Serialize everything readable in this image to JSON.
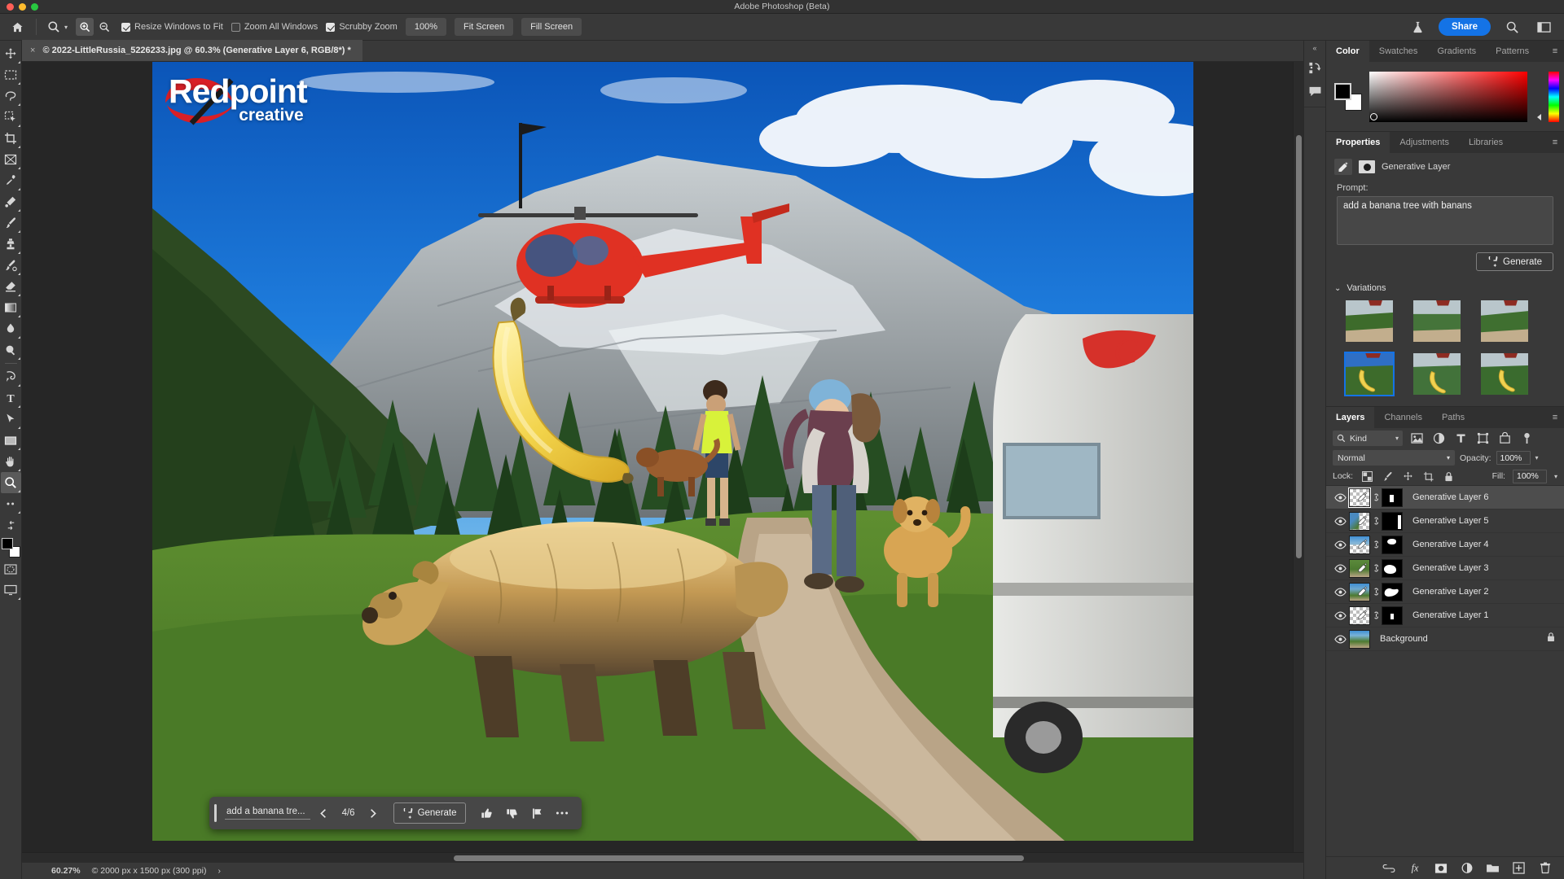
{
  "app": {
    "title": "Adobe Photoshop (Beta)"
  },
  "options_bar": {
    "home_icon": "home-icon",
    "tool_icon": "zoom-tool-icon",
    "zoom_in_icon": "zoom-in-icon",
    "zoom_out_icon": "zoom-out-icon",
    "checkboxes": [
      {
        "label": "Resize Windows to Fit",
        "checked": true
      },
      {
        "label": "Zoom All Windows",
        "checked": false
      },
      {
        "label": "Scrubby Zoom",
        "checked": true
      }
    ],
    "buttons": [
      {
        "label": "100%"
      },
      {
        "label": "Fit Screen"
      },
      {
        "label": "Fill Screen"
      }
    ],
    "share_label": "Share",
    "right_icons": [
      "flask-icon",
      "search-icon",
      "workspace-icon"
    ]
  },
  "document": {
    "tab_title": "© 2022-LittleRussia_5226233.jpg @ 60.3% (Generative Layer 6, RGB/8*) *",
    "close_glyph": "×"
  },
  "status_bar": {
    "zoom": "60.27%",
    "dimensions": "© 2000 px x 1500 px (300 ppi)",
    "chevron": "›"
  },
  "canvas": {
    "watermark_line1": "Redpoint",
    "watermark_line2": "creative",
    "logo_name": "redpoint-logo",
    "brand_color": "#d81f26"
  },
  "gen_taskbar": {
    "prompt_display": "add a banana tre...",
    "prev_glyph": "‹",
    "next_glyph": "›",
    "counter": "4/6",
    "generate_label": "Generate",
    "icons": [
      "thumbs-up-icon",
      "thumbs-down-icon",
      "flag-icon",
      "more-options-icon"
    ]
  },
  "rail": {
    "collapse_glyph": "«",
    "icons": [
      "history-icon",
      "comment-icon"
    ]
  },
  "color_panel": {
    "tabs": [
      {
        "label": "Color",
        "active": true
      },
      {
        "label": "Swatches",
        "active": false
      },
      {
        "label": "Gradients",
        "active": false
      },
      {
        "label": "Patterns",
        "active": false
      }
    ],
    "foreground": "#000000",
    "background": "#ffffff",
    "menu_glyph": "≡"
  },
  "properties_panel": {
    "tabs": [
      {
        "label": "Properties",
        "active": true
      },
      {
        "label": "Adjustments",
        "active": false
      },
      {
        "label": "Libraries",
        "active": false
      }
    ],
    "menu_glyph": "≡",
    "layer_type": "Generative Layer",
    "prompt_label": "Prompt:",
    "prompt_value": "add a banana tree with banans",
    "generate_label": "Generate",
    "variations_label": "Variations",
    "variations_chevron": "⌄",
    "variations": [
      {
        "selected": false,
        "has_banana": false
      },
      {
        "selected": false,
        "has_banana": false
      },
      {
        "selected": false,
        "has_banana": false
      },
      {
        "selected": true,
        "has_banana": true
      },
      {
        "selected": false,
        "has_banana": true
      },
      {
        "selected": false,
        "has_banana": true
      }
    ]
  },
  "layers_panel": {
    "tabs": [
      {
        "label": "Layers",
        "active": true
      },
      {
        "label": "Channels",
        "active": false
      },
      {
        "label": "Paths",
        "active": false
      }
    ],
    "menu_glyph": "≡",
    "filter_kind": "Kind",
    "filter_icons": [
      "pixel-filter-icon",
      "adjustment-filter-icon",
      "type-filter-icon",
      "shape-filter-icon",
      "smartobject-filter-icon"
    ],
    "filter_toggle": "filter-toggle-icon",
    "blend_mode": "Normal",
    "opacity_label": "Opacity:",
    "opacity_value": "100%",
    "lock_label": "Lock:",
    "lock_icons": [
      "lock-transparent-icon",
      "lock-image-icon",
      "lock-position-icon",
      "lock-artboard-icon",
      "lock-all-icon"
    ],
    "fill_label": "Fill:",
    "fill_value": "100%",
    "layers": [
      {
        "name": "Generative Layer 6",
        "visible": true,
        "selected": true,
        "type": "generative",
        "mask": "small-center",
        "locked": false
      },
      {
        "name": "Generative Layer 5",
        "visible": true,
        "selected": false,
        "type": "generative",
        "mask": "right-bar",
        "locked": false
      },
      {
        "name": "Generative Layer 4",
        "visible": true,
        "selected": false,
        "type": "generative",
        "mask": "top-blob",
        "locked": false
      },
      {
        "name": "Generative Layer 3",
        "visible": true,
        "selected": false,
        "type": "generative",
        "mask": "big-blob",
        "locked": false
      },
      {
        "name": "Generative Layer 2",
        "visible": true,
        "selected": false,
        "type": "generative",
        "mask": "curve-blob",
        "locked": false
      },
      {
        "name": "Generative Layer 1",
        "visible": true,
        "selected": false,
        "type": "generative",
        "mask": "tiny-center",
        "locked": false
      },
      {
        "name": "Background",
        "visible": true,
        "selected": false,
        "type": "background",
        "mask": "none",
        "locked": true
      }
    ],
    "footer_icons": [
      "link-layers-icon",
      "layer-style-icon",
      "add-mask-icon",
      "adjustment-layer-icon",
      "new-group-icon",
      "new-layer-icon",
      "delete-layer-icon"
    ]
  }
}
